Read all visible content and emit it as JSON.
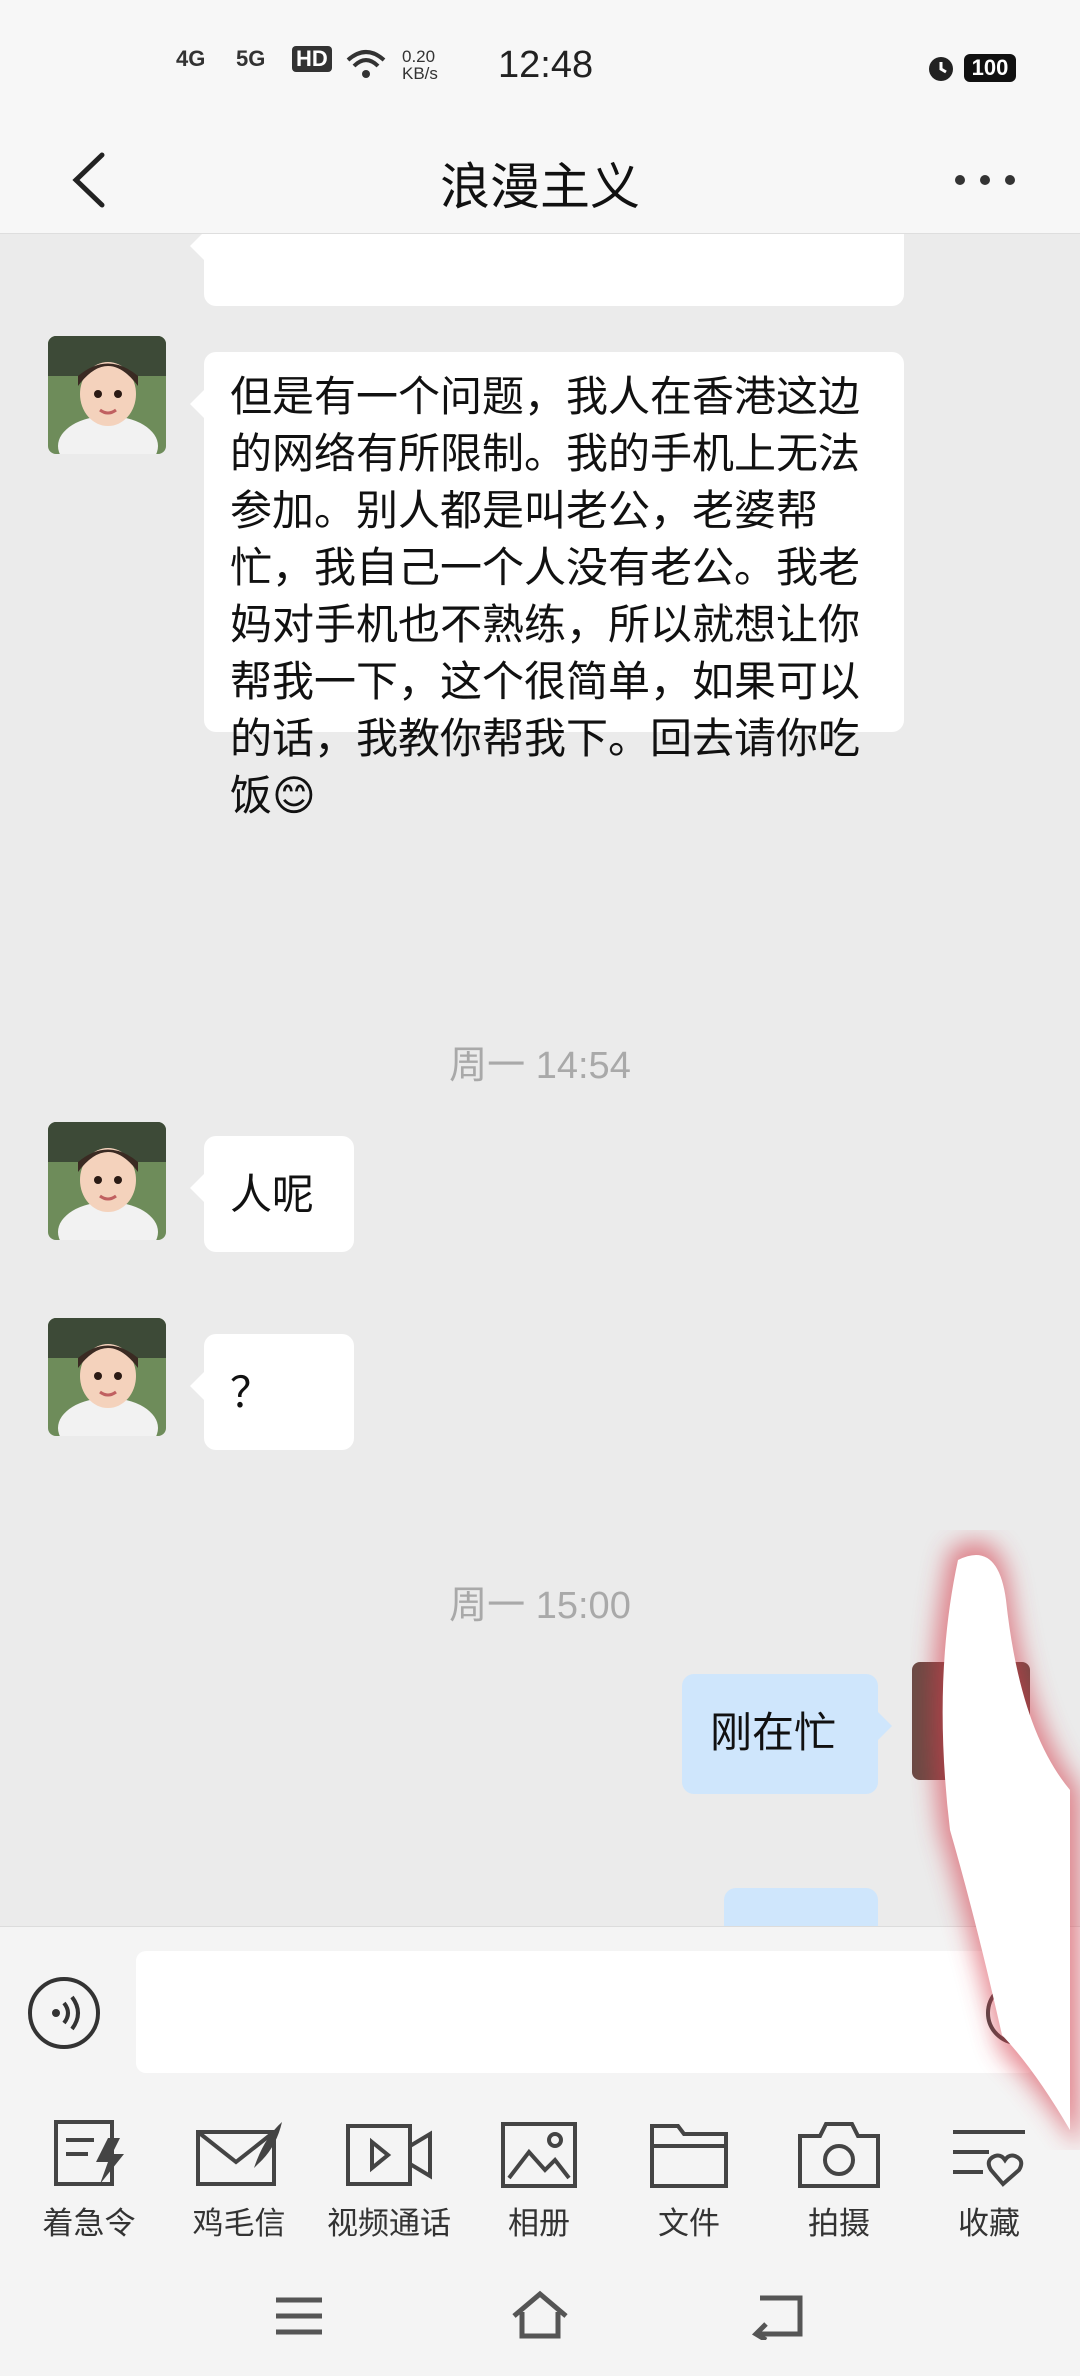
{
  "status_bar": {
    "network1": "4G",
    "network2": "5G",
    "hd": "HD",
    "speed": "0.20 KB/s",
    "time": "12:48",
    "battery": "100"
  },
  "header": {
    "title": "浪漫主义"
  },
  "messages": [
    {
      "side": "left",
      "text": "但是有一个问题，我人在香港这边的网络有所限制。我的手机上无法参加。别人都是叫老公，老婆帮忙，我自己一个人没有老公。我老妈对手机也不熟练，所以就想让你帮我一下，这个很简单，如果可以的话，我教你帮我下。回去请你吃饭😊"
    },
    {
      "type": "time",
      "text": "周一 14:54"
    },
    {
      "side": "left",
      "text": "人呢"
    },
    {
      "side": "left",
      "text": "？"
    },
    {
      "type": "time",
      "text": "周一 15:00"
    },
    {
      "side": "right",
      "text": "刚在忙"
    }
  ],
  "toolbar": [
    {
      "label": "着急令",
      "icon": "urgent-message-icon"
    },
    {
      "label": "鸡毛信",
      "icon": "feather-letter-icon"
    },
    {
      "label": "视频通话",
      "icon": "video-call-icon"
    },
    {
      "label": "相册",
      "icon": "album-icon"
    },
    {
      "label": "文件",
      "icon": "folder-icon"
    },
    {
      "label": "拍摄",
      "icon": "camera-icon"
    },
    {
      "label": "收藏",
      "icon": "favorite-icon"
    }
  ]
}
